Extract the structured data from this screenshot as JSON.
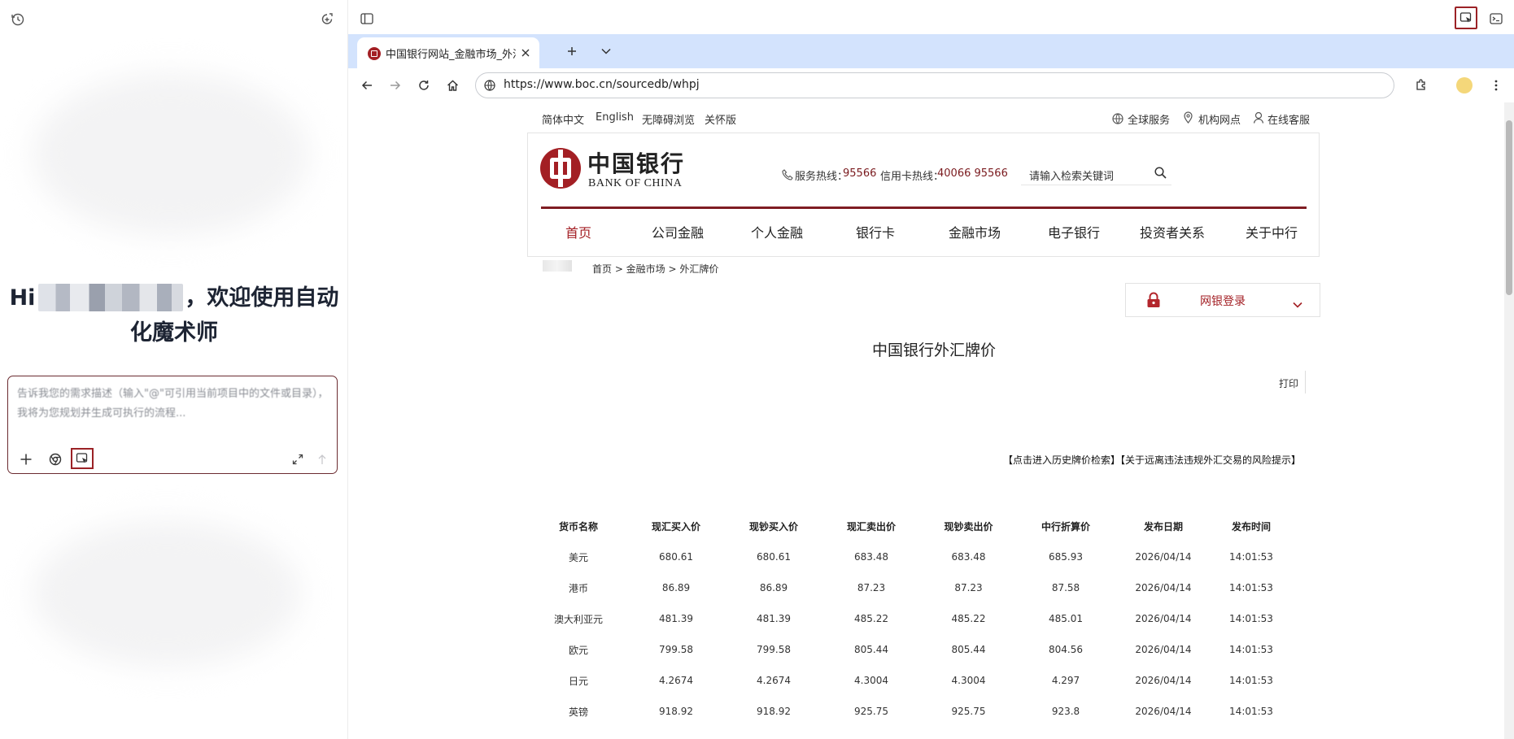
{
  "assistant": {
    "greeting_hi": "Hi",
    "greeting_rest": "，欢迎使用自动",
    "greeting_line2": "化魔术师",
    "input_placeholder": "告诉我您的需求描述（输入\"@\"可引用当前项目中的文件或目录），我将为您规划并生成可执行的流程..."
  },
  "browser": {
    "tab_title": "中国银行网站_金融市场_外汇",
    "url": "https://www.boc.cn/sourcedb/whpj"
  },
  "site": {
    "lang_links": [
      "简体中文",
      "English",
      "无障碍浏览",
      "关怀版"
    ],
    "util_links": [
      "全球服务",
      "机构网点",
      "在线客服"
    ],
    "logo_cn": "中国银行",
    "logo_en": "BANK OF CHINA",
    "hotline_label": "服务热线：",
    "hotline_number": "95566",
    "card_hotline_label": "信用卡热线：",
    "card_hotline_number": "40066 95566",
    "search_placeholder": "请输入检索关键词",
    "nav": [
      "首页",
      "公司金融",
      "个人金融",
      "银行卡",
      "金融市场",
      "电子银行",
      "投资者关系",
      "关于中行"
    ],
    "breadcrumb": "首页 > 金融市场 > 外汇牌价",
    "login_label": "网银登录",
    "page_title": "中国银行外汇牌价",
    "print_label": "打印",
    "history_link": "【点击进入历史牌价检索】【关于远离违法违规外汇交易的风险提示】"
  },
  "rates": {
    "headers": [
      "货币名称",
      "现汇买入价",
      "现钞买入价",
      "现汇卖出价",
      "现钞卖出价",
      "中行折算价",
      "发布日期",
      "发布时间"
    ],
    "rows": [
      [
        "美元",
        "680.61",
        "680.61",
        "683.48",
        "683.48",
        "685.93",
        "2026/04/14",
        "14:01:53"
      ],
      [
        "港币",
        "86.89",
        "86.89",
        "87.23",
        "87.23",
        "87.58",
        "2026/04/14",
        "14:01:53"
      ],
      [
        "澳大利亚元",
        "481.39",
        "481.39",
        "485.22",
        "485.22",
        "485.01",
        "2026/04/14",
        "14:01:53"
      ],
      [
        "欧元",
        "799.58",
        "799.58",
        "805.44",
        "805.44",
        "804.56",
        "2026/04/14",
        "14:01:53"
      ],
      [
        "日元",
        "4.2674",
        "4.2674",
        "4.3004",
        "4.3004",
        "4.297",
        "2026/04/14",
        "14:01:53"
      ],
      [
        "英镑",
        "918.92",
        "918.92",
        "925.75",
        "925.75",
        "923.8",
        "2026/04/14",
        "14:01:53"
      ]
    ]
  },
  "colors": {
    "boc_red": "#a31f24",
    "tab_strip": "#d3e3fd",
    "accent_dark_red": "#6b2b30"
  }
}
